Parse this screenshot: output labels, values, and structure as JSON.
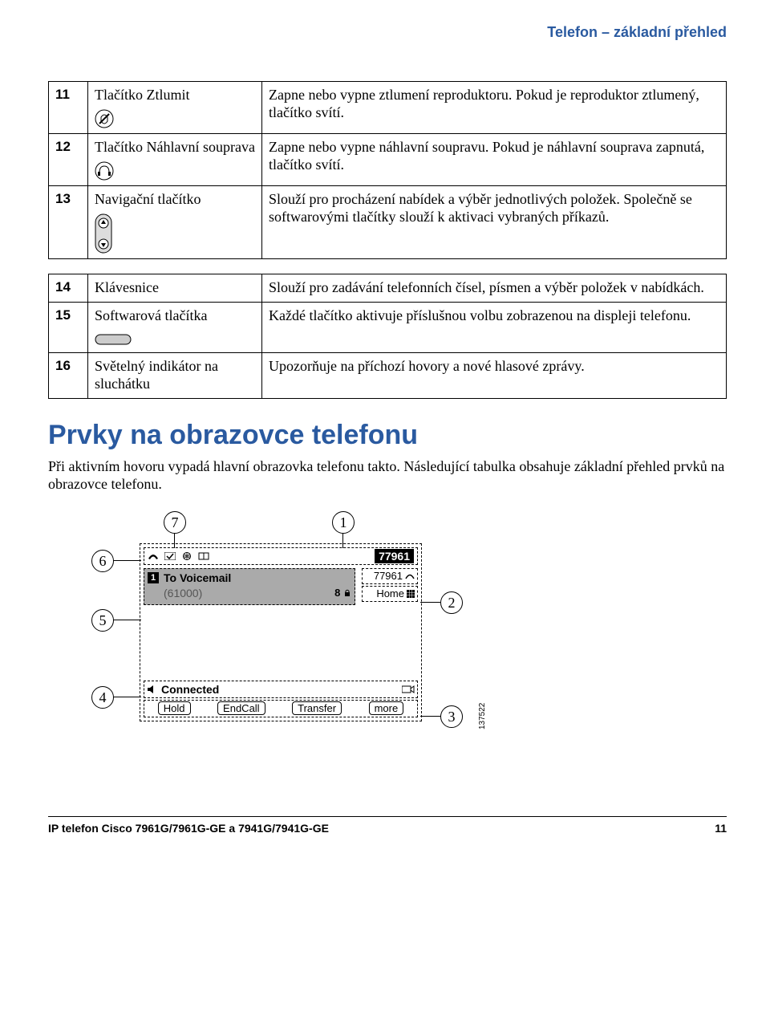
{
  "header": {
    "title": "Telefon – základní přehled"
  },
  "table1": {
    "rows": [
      {
        "num": "11",
        "label": "Tlačítko Ztlumit",
        "desc": "Zapne nebo vypne ztlumení reproduktoru. Pokud je reproduktor ztlumený, tlačítko svítí."
      },
      {
        "num": "12",
        "label": "Tlačítko Náhlavní souprava",
        "desc": "Zapne nebo vypne náhlavní soupravu. Pokud je náhlavní souprava zapnutá, tlačítko svítí."
      },
      {
        "num": "13",
        "label": "Navigační tlačítko",
        "desc": "Slouží pro procházení nabídek a výběr jednotlivých položek. Společně se softwarovými tlačítky slouží k aktivaci vybraných příkazů."
      }
    ]
  },
  "table2": {
    "rows": [
      {
        "num": "14",
        "label": "Klávesnice",
        "desc": "Slouží pro zadávání telefonních čísel, písmen a výběr položek v nabídkách."
      },
      {
        "num": "15",
        "label": "Softwarová tlačítka",
        "desc": "Každé tlačítko aktivuje příslušnou volbu zobrazenou na displeji telefonu."
      },
      {
        "num": "16",
        "label": "Světelný indikátor na sluchátku",
        "desc": "Upozorňuje na příchozí hovory a nové hlasové zprávy."
      }
    ]
  },
  "section": {
    "title": "Prvky na obrazovce telefonu",
    "intro": "Při aktivním hovoru vypadá hlavní obrazovka telefonu takto. Následující tabulka obsahuje základní přehled prvků na obrazovce telefonu."
  },
  "diagram": {
    "callouts": {
      "c1": "1",
      "c2": "2",
      "c3": "3",
      "c4": "4",
      "c5": "5",
      "c6": "6",
      "c7": "7"
    },
    "ext_main": "77961",
    "line1_ext": "77961",
    "line2_label": "Home",
    "call_title": "To Voicemail",
    "call_sub": "(61000)",
    "call_right": "8",
    "status_text": "Connected",
    "softkeys": {
      "k1": "Hold",
      "k2": "EndCall",
      "k3": "Transfer",
      "k4": "more"
    },
    "image_id": "137522"
  },
  "footer": {
    "left": "IP telefon Cisco 7961G/7961G-GE a 7941G/7941G-GE",
    "right": "11"
  }
}
